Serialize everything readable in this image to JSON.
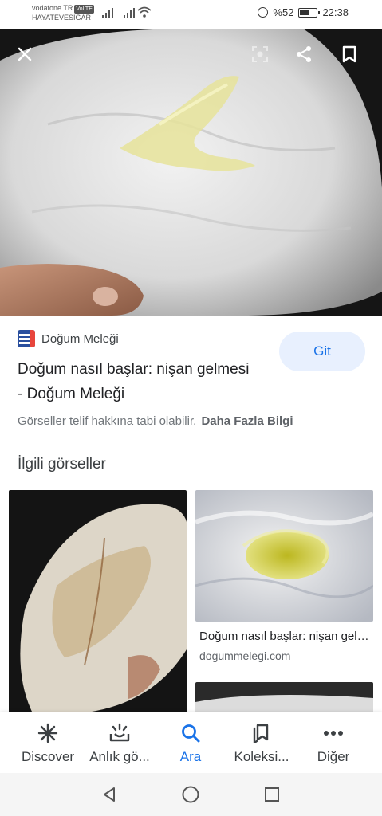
{
  "status_bar": {
    "carrier_line1": "vodafone TR",
    "volte_badge": "VoLTE",
    "carrier_line2": "HAYATEVESIGAR",
    "battery_text": "%52",
    "time": "22:38"
  },
  "image_viewer": {
    "close_icon": "close-icon",
    "lens_icon": "lens-icon",
    "share_icon": "share-icon",
    "bookmark_icon": "bookmark-icon"
  },
  "result": {
    "source_name": "Doğum Meleği",
    "title": "Doğum nasıl başlar: nişan gelmesi - Doğum Meleği",
    "visit_label": "Git",
    "copyright_notice": "Görseller telif hakkına tabi olabilir.",
    "more_info_link": "Daha Fazla Bilgi"
  },
  "related": {
    "heading": "İlgili görseller",
    "cards": [
      {
        "title": "Doğum nasıl başlar: nişan gelmesi",
        "domain": "dogummelegi.com"
      }
    ]
  },
  "bottom_nav": {
    "items": [
      {
        "label": "Discover",
        "icon": "asterisk-icon"
      },
      {
        "label": "Anlık gö...",
        "icon": "updates-icon"
      },
      {
        "label": "Ara",
        "icon": "search-icon",
        "active": true
      },
      {
        "label": "Koleksi...",
        "icon": "collections-icon"
      },
      {
        "label": "Diğer",
        "icon": "more-icon"
      }
    ]
  },
  "colors": {
    "accent": "#1a73e8",
    "button_bg": "#e8f0fe",
    "text_primary": "#202124",
    "text_secondary": "#70757a"
  }
}
